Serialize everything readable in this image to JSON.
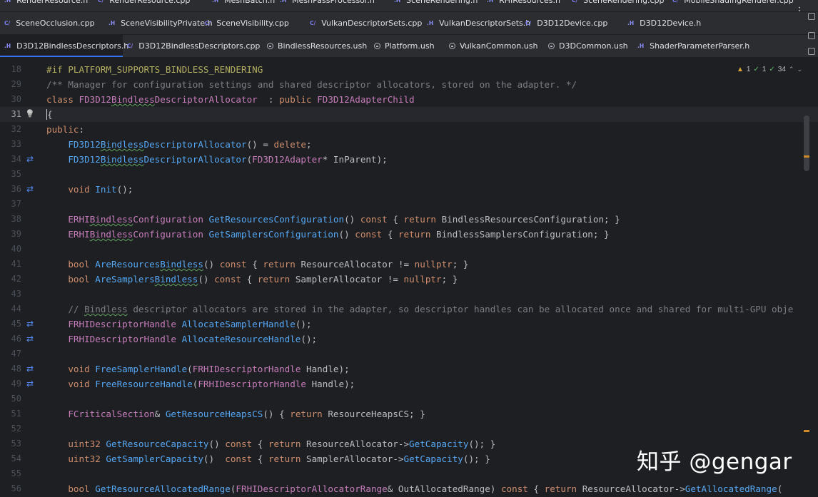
{
  "tabs": {
    "row1": [
      {
        "label": "RenderResource.h",
        "type": "h"
      },
      {
        "label": "RenderResource.cpp",
        "type": "cpp"
      },
      {
        "label": "MeshBatch.h",
        "type": "h"
      },
      {
        "label": "MeshPassProcessor.h",
        "type": "h"
      },
      {
        "label": "SceneRendering.h",
        "type": "h"
      },
      {
        "label": "RHIResources.h",
        "type": "h"
      },
      {
        "label": "SceneRendering.cpp",
        "type": "cpp"
      },
      {
        "label": "MobileShadingRenderer.cpp",
        "type": "cpp"
      }
    ],
    "row2": [
      {
        "label": "SceneOcclusion.cpp",
        "type": "cpp"
      },
      {
        "label": "SceneVisibilityPrivate.h",
        "type": "h"
      },
      {
        "label": "SceneVisibility.cpp",
        "type": "cpp"
      },
      {
        "label": "VulkanDescriptorSets.cpp",
        "type": "cpp"
      },
      {
        "label": "VulkanDescriptorSets.h",
        "type": "h"
      },
      {
        "label": "D3D12Device.cpp",
        "type": "cpp"
      },
      {
        "label": "D3D12Device.h",
        "type": "h"
      }
    ],
    "row3": [
      {
        "label": "D3D12BindlessDescriptors.h",
        "type": "h",
        "active": true
      },
      {
        "label": "D3D12BindlessDescriptors.cpp",
        "type": "cpp"
      },
      {
        "label": "BindlessResources.ush",
        "type": "ush"
      },
      {
        "label": "Platform.ush",
        "type": "ush"
      },
      {
        "label": "VulkanCommon.ush",
        "type": "ush"
      },
      {
        "label": "D3DCommon.ush",
        "type": "ush"
      },
      {
        "label": "ShaderParameterParser.h",
        "type": "h"
      }
    ],
    "icon_labels": {
      "h": ".H",
      "cpp": "C/"
    },
    "more_icon": "⋮"
  },
  "inspections": {
    "warnings": "1",
    "weak_warnings": "1",
    "typos": "34"
  },
  "watermark": "知乎 @gengar",
  "editor": {
    "current_line": "31",
    "lines": [
      {
        "n": "18",
        "g": ""
      },
      {
        "n": "29",
        "g": ""
      },
      {
        "n": "30",
        "g": ""
      },
      {
        "n": "31",
        "g": "bulb"
      },
      {
        "n": "32",
        "g": ""
      },
      {
        "n": "33",
        "g": ""
      },
      {
        "n": "34",
        "g": "impl"
      },
      {
        "n": "35",
        "g": ""
      },
      {
        "n": "36",
        "g": "impl"
      },
      {
        "n": "37",
        "g": ""
      },
      {
        "n": "38",
        "g": ""
      },
      {
        "n": "39",
        "g": ""
      },
      {
        "n": "40",
        "g": ""
      },
      {
        "n": "41",
        "g": ""
      },
      {
        "n": "42",
        "g": ""
      },
      {
        "n": "43",
        "g": ""
      },
      {
        "n": "44",
        "g": ""
      },
      {
        "n": "45",
        "g": "impl"
      },
      {
        "n": "46",
        "g": "impl"
      },
      {
        "n": "47",
        "g": ""
      },
      {
        "n": "48",
        "g": "impl"
      },
      {
        "n": "49",
        "g": "impl"
      },
      {
        "n": "50",
        "g": ""
      },
      {
        "n": "51",
        "g": ""
      },
      {
        "n": "52",
        "g": ""
      },
      {
        "n": "53",
        "g": ""
      },
      {
        "n": "54",
        "g": ""
      },
      {
        "n": "55",
        "g": ""
      },
      {
        "n": "56",
        "g": ""
      }
    ],
    "code": [
      [
        [
          "mc",
          "#if "
        ],
        [
          "mc",
          "PLATFORM_SUPPORTS_BINDLESS_RENDERING"
        ]
      ],
      [
        [
          "cm",
          "/** Manager for configuration settings and shared descriptor allocators, stored on the adapter. */"
        ]
      ],
      [
        [
          "kw",
          "class "
        ],
        [
          "ty",
          "FD3D12BindlessDescriptorAllocator"
        ],
        [
          "",
          "  : "
        ],
        [
          "kw",
          "public "
        ],
        [
          "ty",
          "FD3D12AdapterChild"
        ]
      ],
      [
        [
          "",
          "{"
        ]
      ],
      [
        [
          "kw",
          "public"
        ],
        [
          "",
          ":"
        ]
      ],
      [
        [
          "",
          "    "
        ],
        [
          "fn",
          "FD3D12BindlessDescriptorAllocator"
        ],
        [
          "",
          "() = "
        ],
        [
          "kw",
          "delete"
        ],
        [
          "",
          ";"
        ]
      ],
      [
        [
          "",
          "    "
        ],
        [
          "fn",
          "FD3D12BindlessDescriptorAllocator"
        ],
        [
          "",
          "("
        ],
        [
          "ty",
          "FD3D12Adapter"
        ],
        [
          "",
          "* "
        ],
        [
          "",
          "InParent);"
        ]
      ],
      [
        [
          "",
          ""
        ]
      ],
      [
        [
          "",
          "    "
        ],
        [
          "kw",
          "void "
        ],
        [
          "fn",
          "Init"
        ],
        [
          "",
          "();"
        ]
      ],
      [
        [
          "",
          ""
        ]
      ],
      [
        [
          "",
          "    "
        ],
        [
          "ty",
          "ERHIBindlessConfiguration "
        ],
        [
          "fn",
          "GetResourcesConfiguration"
        ],
        [
          "",
          "() "
        ],
        [
          "kw",
          "const "
        ],
        [
          "",
          "{ "
        ],
        [
          "kw",
          "return "
        ],
        [
          "",
          "BindlessResourcesConfiguration; }"
        ]
      ],
      [
        [
          "",
          "    "
        ],
        [
          "ty",
          "ERHIBindlessConfiguration "
        ],
        [
          "fn",
          "GetSamplersConfiguration"
        ],
        [
          "",
          "() "
        ],
        [
          "kw",
          "const "
        ],
        [
          "",
          "{ "
        ],
        [
          "kw",
          "return "
        ],
        [
          "",
          "BindlessSamplersConfiguration; }"
        ]
      ],
      [
        [
          "",
          ""
        ]
      ],
      [
        [
          "",
          "    "
        ],
        [
          "kw",
          "bool "
        ],
        [
          "fn",
          "AreResourcesBindless"
        ],
        [
          "",
          "() "
        ],
        [
          "kw",
          "const "
        ],
        [
          "",
          "{ "
        ],
        [
          "kw",
          "return "
        ],
        [
          "",
          "ResourceAllocator != "
        ],
        [
          "kw",
          "nullptr"
        ],
        [
          "",
          "; }"
        ]
      ],
      [
        [
          "",
          "    "
        ],
        [
          "kw",
          "bool "
        ],
        [
          "fn",
          "AreSamplersBindless"
        ],
        [
          "",
          "() "
        ],
        [
          "kw",
          "const "
        ],
        [
          "",
          "{ "
        ],
        [
          "kw",
          "return "
        ],
        [
          "",
          "SamplerAllocator != "
        ],
        [
          "kw",
          "nullptr"
        ],
        [
          "",
          "; }"
        ]
      ],
      [
        [
          "",
          ""
        ]
      ],
      [
        [
          "cm",
          "    // Bindless descriptor allocators are stored in the adapter, so descriptor handles can be allocated once and shared for multi-GPU obje"
        ]
      ],
      [
        [
          "",
          "    "
        ],
        [
          "ty",
          "FRHIDescriptorHandle "
        ],
        [
          "fn",
          "AllocateSamplerHandle"
        ],
        [
          "",
          "();"
        ]
      ],
      [
        [
          "",
          "    "
        ],
        [
          "ty",
          "FRHIDescriptorHandle "
        ],
        [
          "fn",
          "AllocateResourceHandle"
        ],
        [
          "",
          "();"
        ]
      ],
      [
        [
          "",
          ""
        ]
      ],
      [
        [
          "",
          "    "
        ],
        [
          "kw",
          "void "
        ],
        [
          "fn",
          "FreeSamplerHandle"
        ],
        [
          "",
          "("
        ],
        [
          "ty",
          "FRHIDescriptorHandle "
        ],
        [
          "",
          "Handle);"
        ]
      ],
      [
        [
          "",
          "    "
        ],
        [
          "kw",
          "void "
        ],
        [
          "fn",
          "FreeResourceHandle"
        ],
        [
          "",
          "("
        ],
        [
          "ty",
          "FRHIDescriptorHandle "
        ],
        [
          "",
          "Handle);"
        ]
      ],
      [
        [
          "",
          ""
        ]
      ],
      [
        [
          "",
          "    "
        ],
        [
          "ty",
          "FCriticalSection"
        ],
        [
          "",
          "& "
        ],
        [
          "fn",
          "GetResourceHeapsCS"
        ],
        [
          "",
          "() { "
        ],
        [
          "kw",
          "return "
        ],
        [
          "",
          "ResourceHeapsCS; }"
        ]
      ],
      [
        [
          "",
          ""
        ]
      ],
      [
        [
          "",
          "    "
        ],
        [
          "kw",
          "uint32 "
        ],
        [
          "fn",
          "GetResourceCapacity"
        ],
        [
          "",
          "() "
        ],
        [
          "kw",
          "const "
        ],
        [
          "",
          "{ "
        ],
        [
          "kw",
          "return "
        ],
        [
          "",
          "ResourceAllocator->"
        ],
        [
          "fn",
          "GetCapacity"
        ],
        [
          "",
          "(); }"
        ]
      ],
      [
        [
          "",
          "    "
        ],
        [
          "kw",
          "uint32 "
        ],
        [
          "fn",
          "GetSamplerCapacity"
        ],
        [
          "",
          "()  "
        ],
        [
          "kw",
          "const "
        ],
        [
          "",
          "{ "
        ],
        [
          "kw",
          "return "
        ],
        [
          "",
          "SamplerAllocator->"
        ],
        [
          "fn",
          "GetCapacity"
        ],
        [
          "",
          "(); }"
        ]
      ],
      [
        [
          "",
          ""
        ]
      ],
      [
        [
          "",
          "    "
        ],
        [
          "kw",
          "bool "
        ],
        [
          "fn",
          "GetResourceAllocatedRange"
        ],
        [
          "",
          "("
        ],
        [
          "ty",
          "FRHIDescriptorAllocatorRange"
        ],
        [
          "",
          "& "
        ],
        [
          "",
          "OutAllocatedRange) "
        ],
        [
          "kw",
          "const "
        ],
        [
          "",
          "{ "
        ],
        [
          "kw",
          "return "
        ],
        [
          "",
          "ResourceAllocator->"
        ],
        [
          "fn",
          "GetAllocatedRange"
        ],
        [
          "",
          "("
        ]
      ]
    ]
  }
}
